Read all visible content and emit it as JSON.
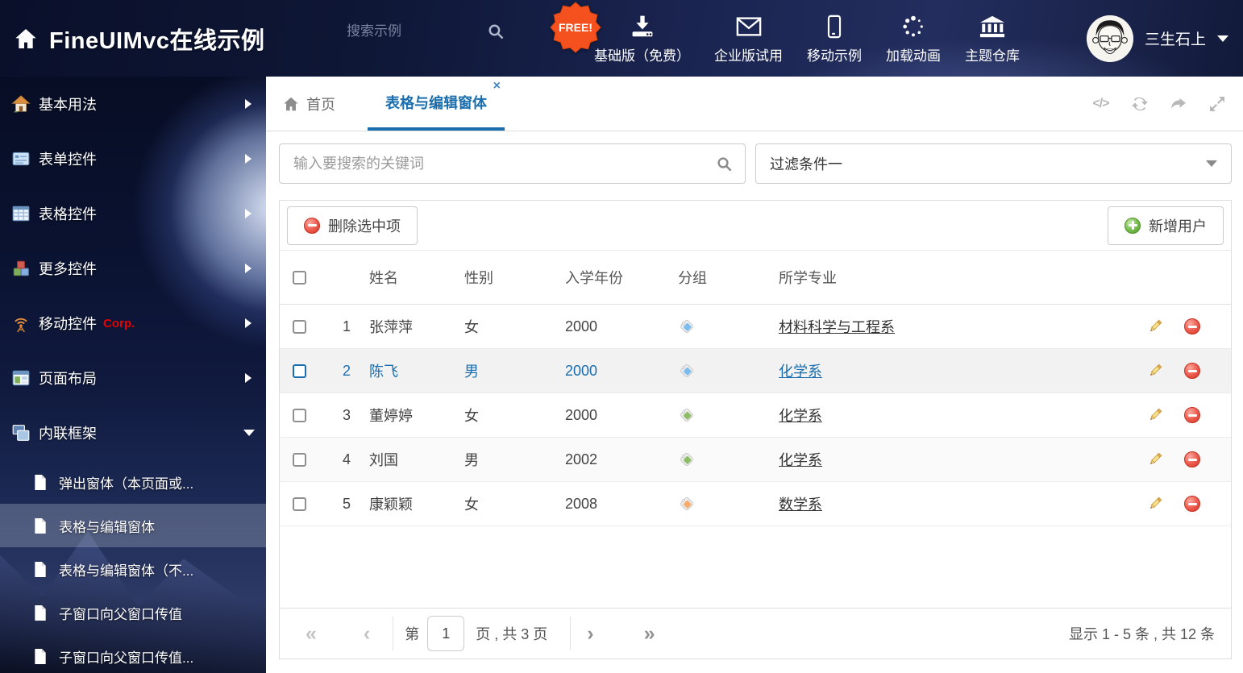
{
  "header": {
    "title": "FineUIMvc在线示例",
    "search_placeholder": "搜索示例",
    "free_badge": "FREE!",
    "nav": [
      {
        "label": "基础版（免费）",
        "icon": "download-icon"
      },
      {
        "label": "企业版试用",
        "icon": "envelope-icon"
      },
      {
        "label": "移动示例",
        "icon": "mobile-icon"
      },
      {
        "label": "加载动画",
        "icon": "spinner-icon"
      },
      {
        "label": "主题仓库",
        "icon": "bank-icon"
      }
    ],
    "user_name": "三生石上"
  },
  "sidebar": {
    "items": [
      {
        "label": "基本用法",
        "icon": "home-colored-icon"
      },
      {
        "label": "表单控件",
        "icon": "form-icon"
      },
      {
        "label": "表格控件",
        "icon": "grid-icon"
      },
      {
        "label": "更多控件",
        "icon": "cubes-icon"
      },
      {
        "label": "移动控件",
        "badge": "Corp.",
        "icon": "antenna-icon"
      },
      {
        "label": "页面布局",
        "icon": "layout-icon"
      },
      {
        "label": "内联框架",
        "icon": "frames-icon",
        "expanded": true
      }
    ],
    "subitems": [
      {
        "label": "弹出窗体（本页面或...",
        "active": false
      },
      {
        "label": "表格与编辑窗体",
        "active": true
      },
      {
        "label": "表格与编辑窗体（不...",
        "active": false
      },
      {
        "label": "子窗口向父窗口传值",
        "active": false
      },
      {
        "label": "子窗口向父窗口传值...",
        "active": false
      }
    ]
  },
  "tabs": [
    {
      "label": "首页",
      "active": false
    },
    {
      "label": "表格与编辑窗体",
      "active": true,
      "closable": true
    }
  ],
  "search": {
    "placeholder": "输入要搜索的关键词"
  },
  "filter": {
    "value": "过滤条件一"
  },
  "toolbar": {
    "delete_label": "删除选中项",
    "add_label": "新增用户"
  },
  "table": {
    "headers": [
      "姓名",
      "性别",
      "入学年份",
      "分组",
      "所学专业"
    ],
    "rows": [
      {
        "num": "1",
        "name": "张萍萍",
        "gender": "女",
        "year": "2000",
        "tag_color": "#7cbdf0",
        "major": "材料科学与工程系",
        "selected": false
      },
      {
        "num": "2",
        "name": "陈飞",
        "gender": "男",
        "year": "2000",
        "tag_color": "#7cbdf0",
        "major": "化学系",
        "selected": true
      },
      {
        "num": "3",
        "name": "董婷婷",
        "gender": "女",
        "year": "2000",
        "tag_color": "#8fbc66",
        "major": "化学系",
        "selected": false
      },
      {
        "num": "4",
        "name": "刘国",
        "gender": "男",
        "year": "2002",
        "tag_color": "#8fbc66",
        "major": "化学系",
        "selected": false
      },
      {
        "num": "5",
        "name": "康颖颖",
        "gender": "女",
        "year": "2008",
        "tag_color": "#f5ad6e",
        "major": "数学系",
        "selected": false
      }
    ]
  },
  "pagination": {
    "page_prefix": "第",
    "page_value": "1",
    "page_suffix": "页 , 共 3 页",
    "summary": "显示 1 - 5 条 , 共 12 条"
  },
  "colors": {
    "accent_blue": "#1a6eae",
    "free_badge_orange": "#f4511e",
    "corp_red": "#e80000"
  }
}
